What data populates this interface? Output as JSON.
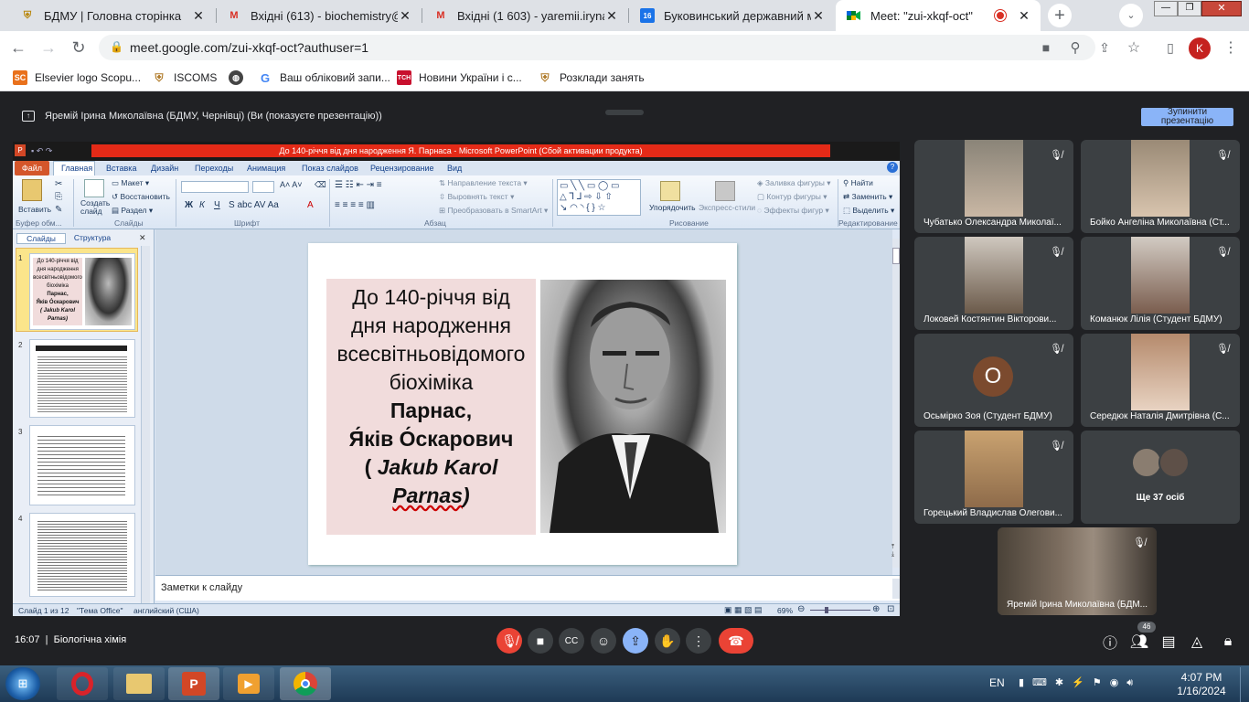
{
  "browser": {
    "tabs": [
      {
        "title": "БДМУ | Головна сторінка",
        "icon": "bdmu-crest-icon"
      },
      {
        "title": "Вхідні (613) - biochemistry@b",
        "icon": "gmail-icon"
      },
      {
        "title": "Вхідні (1 603) - yaremii.iryna@",
        "icon": "gmail-icon"
      },
      {
        "title": "Буковинський державний ме",
        "icon": "calendar-16-icon"
      },
      {
        "title": "Meet: \"zui-xkqf-oct\"",
        "icon": "meet-icon",
        "active": true
      }
    ],
    "url": "meet.google.com/zui-xkqf-oct?authuser=1",
    "profile_initial": "K",
    "bookmarks": [
      {
        "label": "Elsevier logo Scopu...",
        "icon": "scopus-icon"
      },
      {
        "label": "ISCOMS",
        "icon": "iscoms-icon"
      },
      {
        "label": "",
        "icon": "globe-icon"
      },
      {
        "label": "Ваш обліковий запи...",
        "icon": "google-icon"
      },
      {
        "label": "Новини України і с...",
        "icon": "tsn-icon"
      },
      {
        "label": "Розклади занять",
        "icon": "bdmu-crest-icon"
      }
    ]
  },
  "meet": {
    "presenter_text": "Яремій Ірина Миколаївна (БДМУ, Чернівці) (Ви (показуєте презентацію))",
    "stop_button": "Зупинити презентацію",
    "time": "16:07",
    "separator": "|",
    "meeting_name": "Біологічна хімія",
    "participants_badge": "46",
    "participants": [
      {
        "name": "Чубатько Олександра Миколаї...",
        "type": "video"
      },
      {
        "name": "Бойко Ангеліна Миколаївна (Ст...",
        "type": "video"
      },
      {
        "name": "Локовей Костянтин Вікторови...",
        "type": "video"
      },
      {
        "name": "Команюк Лілія (Студент БДМУ)",
        "type": "video"
      },
      {
        "name": "Осьмірко Зоя (Студент БДМУ)",
        "type": "avatar",
        "initial": "О",
        "avatar_color": "#7b4a2e"
      },
      {
        "name": "Середюк Наталія Дмитрівна (С...",
        "type": "video"
      },
      {
        "name": "Горецький Владислав Олегови...",
        "type": "video"
      },
      {
        "more_label": "Ще 37 осіб",
        "type": "more"
      }
    ],
    "self_tile": {
      "name": "Яремій Ірина Миколаївна (БДМ..."
    },
    "controls": [
      "mic-off-icon",
      "camera-icon",
      "captions-icon",
      "emoji-icon",
      "present-icon",
      "raise-hand-icon",
      "more-icon",
      "hang-up-icon"
    ],
    "right_controls": [
      "info-icon",
      "people-icon",
      "chat-icon",
      "activities-icon",
      "lock-icon"
    ]
  },
  "ppt": {
    "window_title": "До 140-річчя від дня народження Я. Парнаса  -  Microsoft PowerPoint (Сбой активации продукта)",
    "file_tab": "Файл",
    "tabs": [
      "Главная",
      "Вставка",
      "Дизайн",
      "Переходы",
      "Анимация",
      "Показ слайдов",
      "Рецензирование",
      "Вид"
    ],
    "ribbon": {
      "paste": "Вставить",
      "clipboard_group": "Буфер обм...",
      "new_slide": "Создать слайд",
      "layout": "Макет",
      "reset": "Восстановить",
      "section": "Раздел",
      "slides_group": "Слайды",
      "font_group": "Шрифт",
      "text_direction": "Направление текста",
      "align_text": "Выровнять текст",
      "smartart": "Преобразовать в SmartArt",
      "paragraph_group": "Абзац",
      "arrange": "Упорядочить",
      "quick_styles": "Экспресс-стили",
      "shape_fill": "Заливка фигуры",
      "shape_outline": "Контур фигуры",
      "shape_effects": "Эффекты фигур",
      "drawing_group": "Рисование",
      "find": "Найти",
      "replace": "Заменить",
      "select": "Выделить",
      "editing_group": "Редактирование"
    },
    "pane_tabs": [
      "Слайды",
      "Структура"
    ],
    "thumb1": {
      "lines": [
        "До 140-річчя від",
        "дня народження",
        "всесвітньовідомого",
        "біохіміка",
        "Парнас,",
        "Я́ків О́скарович",
        "( Jakub Karol",
        "Parnas)"
      ]
    },
    "thumb_nums": [
      "1",
      "2",
      "3",
      "4"
    ],
    "slide": {
      "line1": "До 140-річчя від",
      "line2": "дня народження",
      "line3": "всесвітньовідомого",
      "line4": "біохіміка",
      "line5": "Парнас,",
      "line6": "Я́ків О́скарович",
      "line7a": "( ",
      "line7b": "Jakub Karol",
      "line8": "Parnas",
      "line8b": ")"
    },
    "notes_placeholder": "Заметки к слайду",
    "status": {
      "slide_count": "Слайд 1 из 12",
      "theme": "\"Тема Office\"",
      "language": "английский (США)",
      "zoom": "69%"
    }
  },
  "taskbar": {
    "apps": [
      "start-orb-icon",
      "opera-icon",
      "explorer-icon",
      "powerpoint-icon",
      "media-player-icon",
      "chrome-icon"
    ],
    "lang": "EN",
    "time": "4:07 PM",
    "date": "1/16/2024"
  }
}
